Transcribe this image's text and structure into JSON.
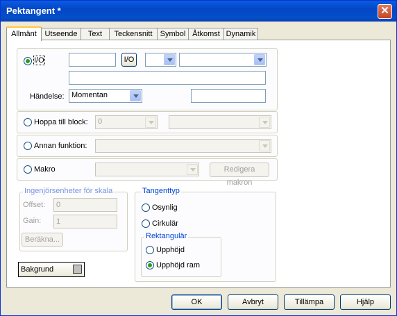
{
  "window": {
    "title": "Pektangent *",
    "close_label": "✕"
  },
  "tabs": [
    {
      "label": "Allmänt"
    },
    {
      "label": "Utseende"
    },
    {
      "label": "Text"
    },
    {
      "label": "Teckensnitt"
    },
    {
      "label": "Symbol"
    },
    {
      "label": "Åtkomst"
    },
    {
      "label": "Dynamik"
    }
  ],
  "io": {
    "radio_label": "I/O",
    "tag_value": "",
    "browse_label": "I/O",
    "combo1_value": "",
    "combo2_value": "",
    "expression_value": "",
    "event_label": "Händelse:",
    "event_value": "Momentan",
    "event_extra_value": ""
  },
  "goto_block": {
    "radio_label": "Hoppa till block:",
    "combo1_value": "0",
    "combo2_value": ""
  },
  "other_function": {
    "radio_label": "Annan funktion:",
    "combo_value": ""
  },
  "macro": {
    "radio_label": "Makro",
    "combo_value": "",
    "edit_label": "Redigera makron"
  },
  "scaling": {
    "title": "Ingenjörsenheter för skala",
    "offset_label": "Offset:",
    "offset_value": "0",
    "gain_label": "Gain:",
    "gain_value": "1",
    "calc_label": "Beräkna..."
  },
  "key_type": {
    "title": "Tangenttyp",
    "invisible_label": "Osynlig",
    "circular_label": "Cirkulär",
    "rect_title": "Rektangulär",
    "raised_label": "Upphöjd",
    "raised_frame_label": "Upphöjd ram"
  },
  "background": {
    "label": "Bakgrund",
    "color": "#c0c0c0"
  },
  "footer": {
    "ok": "OK",
    "cancel": "Avbryt",
    "apply": "Tillämpa",
    "help": "Hjälp"
  }
}
